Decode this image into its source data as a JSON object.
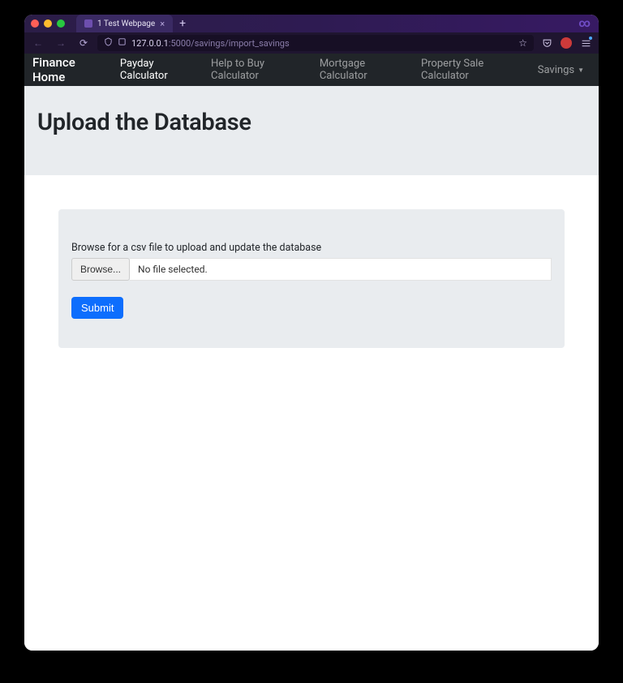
{
  "browser": {
    "tab_title": "1 Test Webpage",
    "url_prefix": "127.0.0.1",
    "url_suffix": ":5000/savings/import_savings"
  },
  "nav": {
    "brand": "Finance Home",
    "links": [
      "Payday Calculator",
      "Help to Buy Calculator",
      "Mortgage Calculator",
      "Property Sale Calculator"
    ],
    "dropdown": "Savings"
  },
  "hero": {
    "title": "Upload the Database"
  },
  "form": {
    "label": "Browse for a csv file to upload and update the database",
    "browse_label": "Browse...",
    "file_status": "No file selected.",
    "submit_label": "Submit"
  }
}
